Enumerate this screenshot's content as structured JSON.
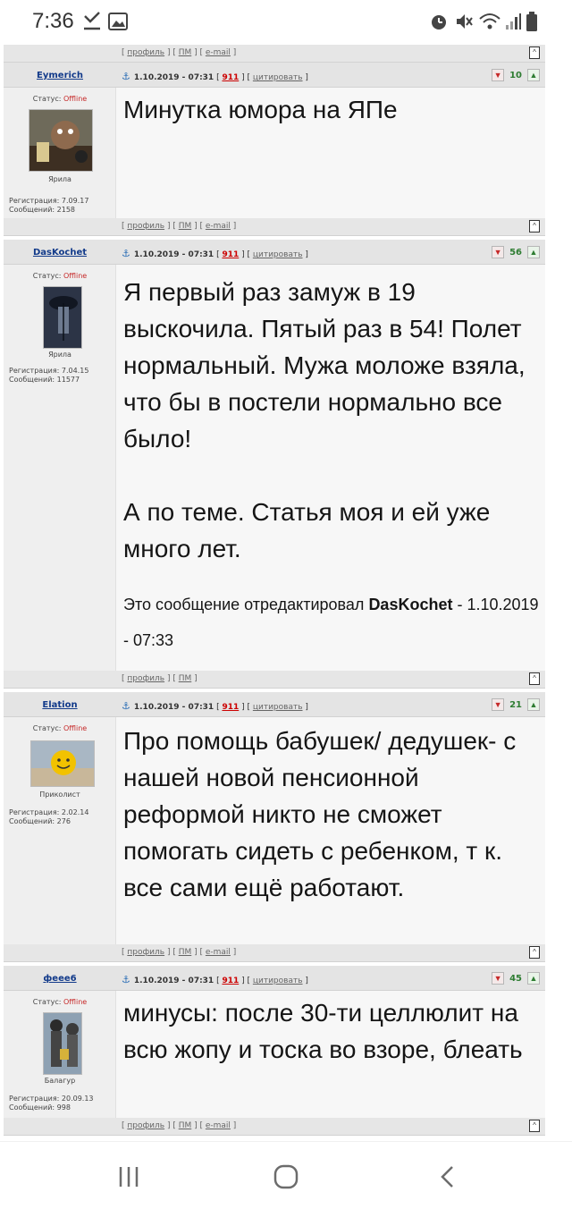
{
  "status_bar": {
    "time": "7:36",
    "left_icons": [
      "download-done-icon",
      "gallery-icon"
    ],
    "right_icons": [
      "alarm-icon",
      "mute-icon",
      "wifi-icon",
      "signal-icon",
      "battery-icon"
    ]
  },
  "forum": {
    "top_links": {
      "profile": "профиль",
      "pm": "ПМ",
      "email": "e-mail"
    },
    "posts": [
      {
        "author": "Eymerich",
        "status_label": "Статус:",
        "status_value": "Offline",
        "rank": "Ярила",
        "registration": "Регистрация: 7.09.17",
        "messages": "Сообщений: 2158",
        "date": "1.10.2019 - 07:31",
        "number": "911",
        "quote_label": "цитировать",
        "rating": "10",
        "text": "Минутка юмора на ЯПе",
        "links": {
          "profile": "профиль",
          "pm": "ПМ",
          "email": "e-mail"
        }
      },
      {
        "author": "DasKochet",
        "status_label": "Статус:",
        "status_value": "Offline",
        "rank": "Ярила",
        "registration": "Регистрация: 7.04.15",
        "messages": "Сообщений: 11577",
        "date": "1.10.2019 - 07:31",
        "number": "911",
        "quote_label": "цитировать",
        "rating": "56",
        "text": "Я первый раз замуж в 19 выскочила. Пятый раз в 54! Полет нормальный. Мужа моложе взяла, что бы в постели нормально все было!\n\nА по теме. Статья моя и ей уже много лет.",
        "edit_note_prefix": "Это сообщение отредактировал",
        "edit_note_author": "DasKochet",
        "edit_note_date": "- 1.10.2019 - 07:33",
        "links": {
          "profile": "профиль",
          "pm": "ПМ"
        }
      },
      {
        "author": "Elation",
        "status_label": "Статус:",
        "status_value": "Offline",
        "rank": "Приколист",
        "registration": "Регистрация: 2.02.14",
        "messages": "Сообщений: 276",
        "date": "1.10.2019 - 07:31",
        "number": "911",
        "quote_label": "цитировать",
        "rating": "21",
        "text": "Про помощь бабушек/ дедушек- с нашей новой пенсионной реформой никто не сможет помогать сидеть с ребенком, т к. все сами ещё работают.",
        "links": {
          "profile": "профиль",
          "pm": "ПМ",
          "email": "e-mail"
        }
      },
      {
        "author": "феее6",
        "status_label": "Статус:",
        "status_value": "Offline",
        "rank": "Балагур",
        "registration": "Регистрация: 20.09.13",
        "messages": "Сообщений: 998",
        "date": "1.10.2019 - 07:31",
        "number": "911",
        "quote_label": "цитировать",
        "rating": "45",
        "text": "минусы: после 30-ти целлюлит на всю жопу и тоска во взоре, блеать",
        "links": {
          "profile": "профиль",
          "pm": "ПМ",
          "email": "e-mail"
        }
      }
    ]
  },
  "nav_bar": {
    "icons": [
      "recent-apps-icon",
      "home-icon",
      "back-icon"
    ]
  }
}
